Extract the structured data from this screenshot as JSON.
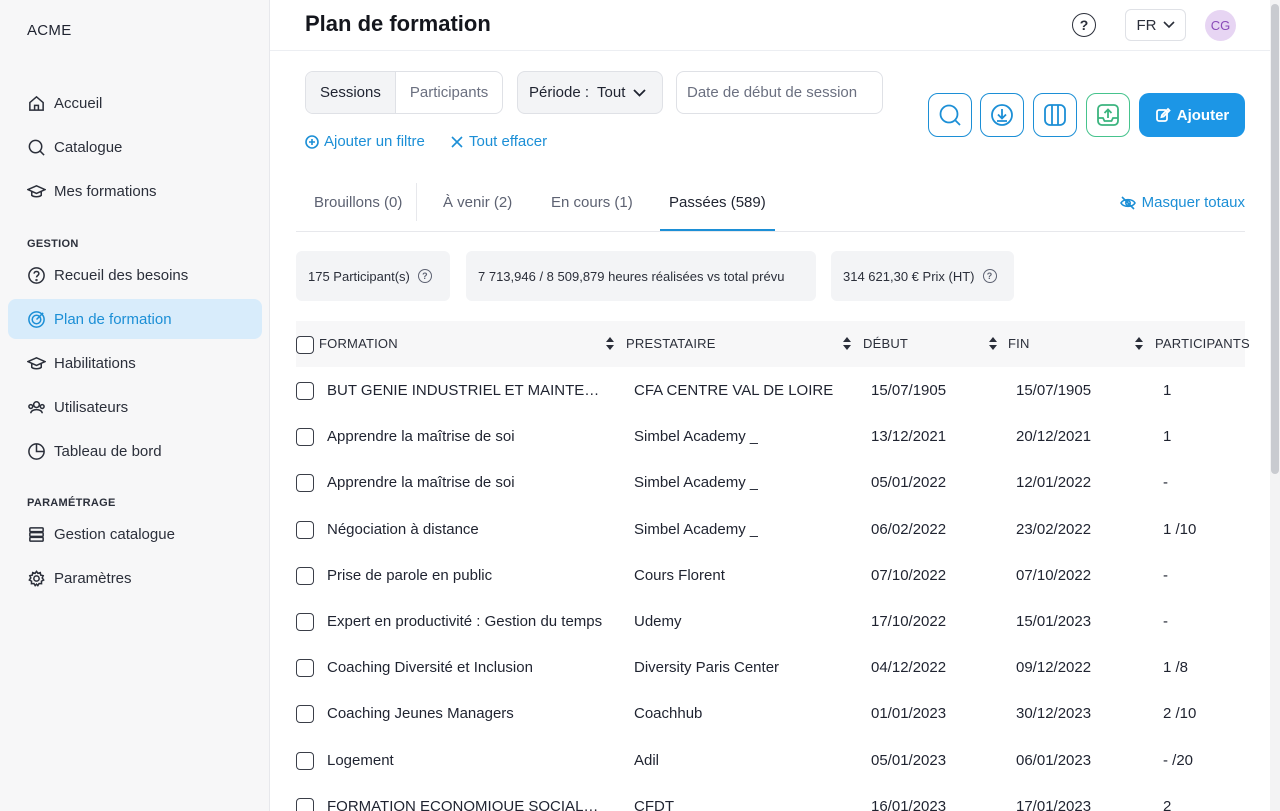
{
  "brand": "ACME",
  "sidebar": {
    "items": [
      {
        "label": "Accueil",
        "icon": "home-icon"
      },
      {
        "label": "Catalogue",
        "icon": "search-icon"
      },
      {
        "label": "Mes formations",
        "icon": "graduation-cap-icon"
      }
    ],
    "gestion_title": "GESTION",
    "gestion_items": [
      {
        "label": "Recueil des besoins",
        "icon": "question-circle-icon"
      },
      {
        "label": "Plan de formation",
        "icon": "target-icon",
        "active": true
      },
      {
        "label": "Habilitations",
        "icon": "graduation-cap-icon"
      },
      {
        "label": "Utilisateurs",
        "icon": "users-icon"
      },
      {
        "label": "Tableau de bord",
        "icon": "pie-chart-icon"
      }
    ],
    "param_title": "PARAMÉTRAGE",
    "param_items": [
      {
        "label": "Gestion catalogue",
        "icon": "stack-icon"
      },
      {
        "label": "Paramètres",
        "icon": "gear-icon"
      }
    ]
  },
  "header": {
    "title": "Plan de formation",
    "help": "?",
    "lang": "FR",
    "avatar": "CG"
  },
  "filters": {
    "seg_sessions": "Sessions",
    "seg_participants": "Participants",
    "periode_label": "Période :",
    "periode_value": "Tout",
    "date_placeholder": "Date de début de session",
    "add_filter": "Ajouter un filtre",
    "clear_all": "Tout effacer",
    "add_button": "Ajouter"
  },
  "tabs": [
    {
      "label": "Brouillons (0)"
    },
    {
      "label": "À venir (2)"
    },
    {
      "label": "En cours (1)"
    },
    {
      "label": "Passées (589)",
      "active": true
    }
  ],
  "mask_totals": "Masquer totaux",
  "stats": {
    "participants": "175 Participant(s)",
    "hours": "7 713,946 / 8 509,879 heures réalisées vs total prévu",
    "price": "314 621,30 € Prix (HT)"
  },
  "table": {
    "headers": [
      "FORMATION",
      "PRESTATAIRE",
      "DÉBUT",
      "FIN",
      "PARTICIPANTS"
    ],
    "rows": [
      [
        "BUT GENIE INDUSTRIEL ET MAINTENANCE",
        "CFA CENTRE VAL DE LOIRE",
        "15/07/1905",
        "15/07/1905",
        "1"
      ],
      [
        "Apprendre la maîtrise de soi",
        "Simbel Academy _",
        "13/12/2021",
        "20/12/2021",
        "1"
      ],
      [
        "Apprendre la maîtrise de soi",
        "Simbel Academy _",
        "05/01/2022",
        "12/01/2022",
        "-"
      ],
      [
        "Négociation à distance",
        "Simbel Academy _",
        "06/02/2022",
        "23/02/2022",
        "1 /10"
      ],
      [
        "Prise de parole en public",
        "Cours Florent",
        "07/10/2022",
        "07/10/2022",
        "-"
      ],
      [
        "Expert en productivité : Gestion du temps",
        "Udemy",
        "17/10/2022",
        "15/01/2023",
        "-"
      ],
      [
        "Coaching Diversité et Inclusion",
        "Diversity Paris Center",
        "04/12/2022",
        "09/12/2022",
        "1 /8"
      ],
      [
        "Coaching Jeunes Managers",
        "Coachhub",
        "01/01/2023",
        "30/12/2023",
        "2 /10"
      ],
      [
        "Logement",
        "Adil",
        "05/01/2023",
        "06/01/2023",
        "- /20"
      ],
      [
        "FORMATION ECONOMIQUE SOCIALE ET SYNDICALE",
        "CFDT",
        "16/01/2023",
        "17/01/2023",
        "2"
      ]
    ]
  },
  "colors": {
    "accent": "#1c8fd6",
    "accent_bg": "#d8ecfb",
    "add_button": "#1c96e6",
    "green": "#3bb47e",
    "avatar_bg": "#e7d5f3"
  }
}
